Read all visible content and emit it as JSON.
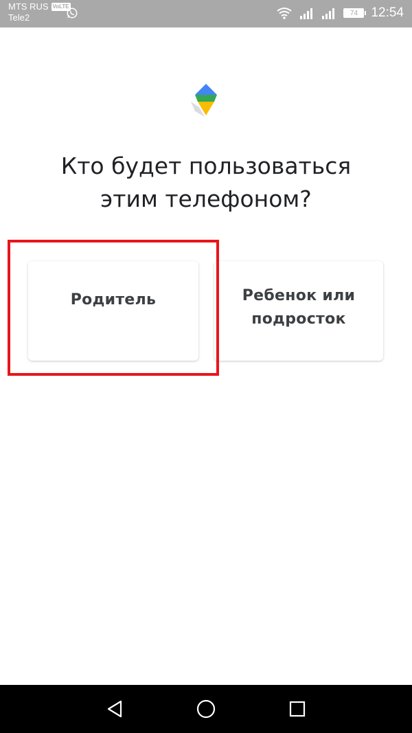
{
  "status_bar": {
    "carrier1": "MTS RUS",
    "volte": "VoLTE",
    "carrier2": "Tele2",
    "battery_level": "74",
    "time": "12:54"
  },
  "title_line1": "Кто будет пользоваться",
  "title_line2": "этим телефоном?",
  "options": {
    "parent": "Родитель",
    "child_line1": "Ребенок или",
    "child_line2": "подросток"
  },
  "colors": {
    "status_bar_bg": "#a9a9a9",
    "highlight": "#e8151b",
    "nav_bar_bg": "#000000"
  },
  "icons": [
    "whatsapp-icon",
    "wifi-icon",
    "signal-icon",
    "battery-icon",
    "family-link-logo-icon",
    "back-icon",
    "home-icon",
    "recents-icon"
  ]
}
